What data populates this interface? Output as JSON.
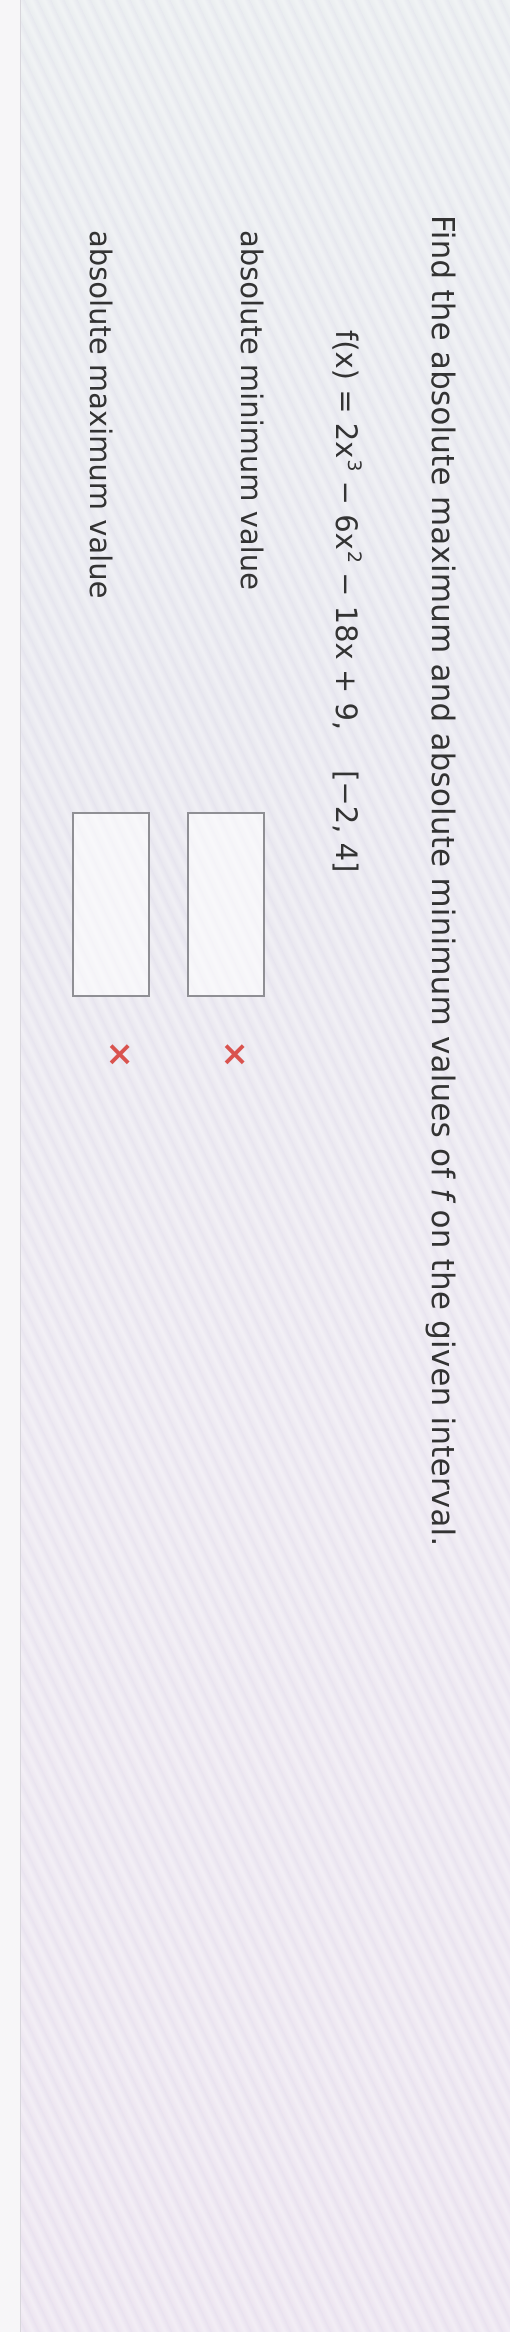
{
  "question": {
    "prefix": "Find the absolute maximum and absolute minimum values of ",
    "variable": "f",
    "suffix": " on the given interval."
  },
  "formula": {
    "lhs": "f(x) = 2x",
    "exp1": "3",
    "mid": " − 6x",
    "exp2": "2",
    "rest": " − 18x + 9,",
    "interval": "[−2, 4]"
  },
  "answers": {
    "minimum": {
      "label": "absolute minimum value",
      "value": "",
      "status": "incorrect"
    },
    "maximum": {
      "label": "absolute maximum value",
      "value": "",
      "status": "incorrect"
    }
  },
  "icons": {
    "incorrect": "×"
  },
  "colors": {
    "text": "#333333",
    "incorrect": "#d9534f",
    "box_border": "#8f8f94"
  }
}
